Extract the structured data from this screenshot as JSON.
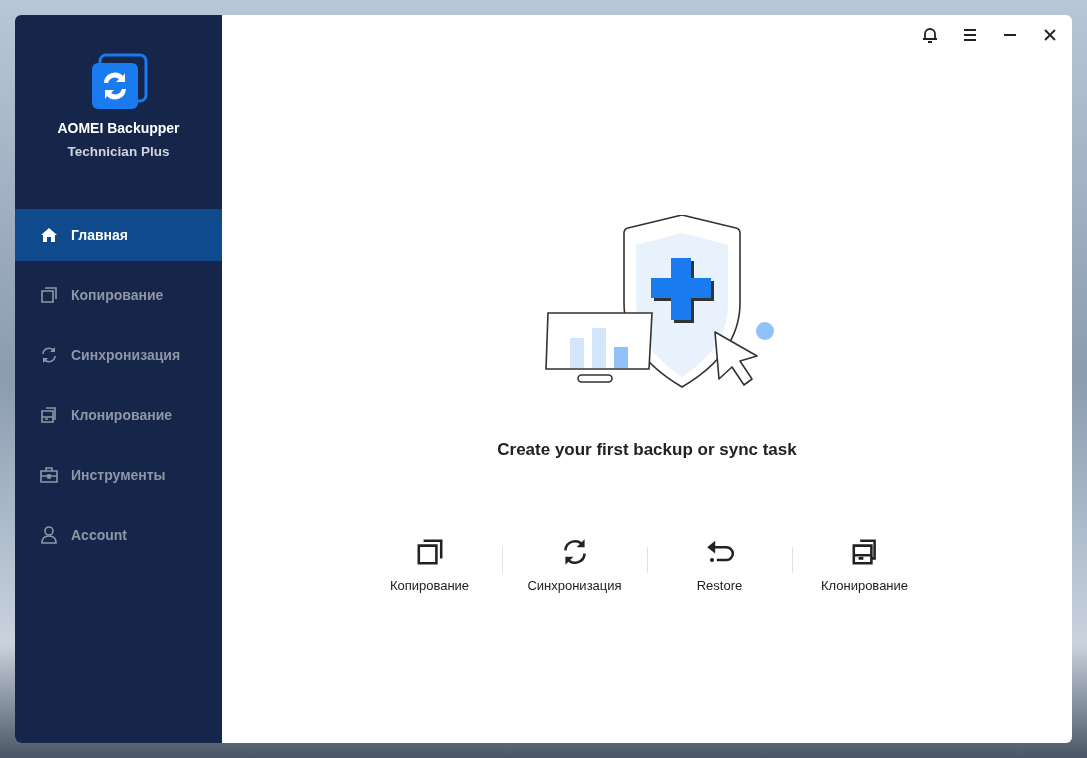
{
  "app": {
    "name": "AOMEI Backupper",
    "edition": "Technician Plus"
  },
  "sidebar": {
    "items": [
      {
        "label": "Главная",
        "selected": true
      },
      {
        "label": "Копирование",
        "selected": false
      },
      {
        "label": "Синхронизация",
        "selected": false
      },
      {
        "label": "Клонирование",
        "selected": false
      },
      {
        "label": "Инструменты",
        "selected": false
      },
      {
        "label": "Account",
        "selected": false
      }
    ]
  },
  "main": {
    "heading": "Create your first backup or sync task",
    "actions": [
      {
        "label": "Копирование"
      },
      {
        "label": "Синхронизация"
      },
      {
        "label": "Restore"
      },
      {
        "label": "Клонирование"
      }
    ]
  }
}
